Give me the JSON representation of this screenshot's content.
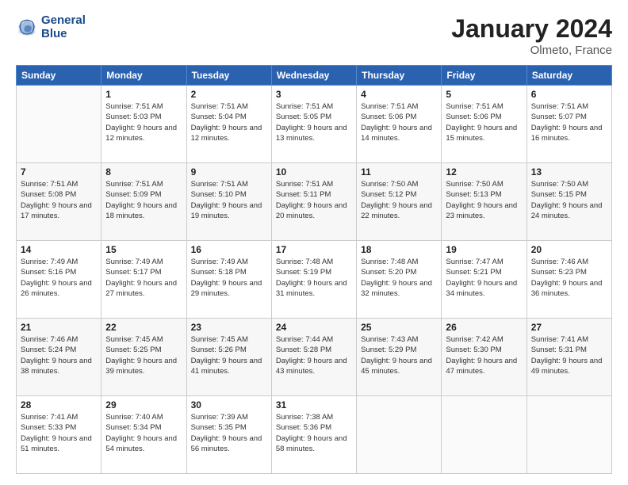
{
  "logo": {
    "line1": "General",
    "line2": "Blue"
  },
  "header": {
    "title": "January 2024",
    "subtitle": "Olmeto, France"
  },
  "weekdays": [
    "Sunday",
    "Monday",
    "Tuesday",
    "Wednesday",
    "Thursday",
    "Friday",
    "Saturday"
  ],
  "weeks": [
    [
      {
        "day": "",
        "sunrise": "",
        "sunset": "",
        "daylight": ""
      },
      {
        "day": "1",
        "sunrise": "Sunrise: 7:51 AM",
        "sunset": "Sunset: 5:03 PM",
        "daylight": "Daylight: 9 hours and 12 minutes."
      },
      {
        "day": "2",
        "sunrise": "Sunrise: 7:51 AM",
        "sunset": "Sunset: 5:04 PM",
        "daylight": "Daylight: 9 hours and 12 minutes."
      },
      {
        "day": "3",
        "sunrise": "Sunrise: 7:51 AM",
        "sunset": "Sunset: 5:05 PM",
        "daylight": "Daylight: 9 hours and 13 minutes."
      },
      {
        "day": "4",
        "sunrise": "Sunrise: 7:51 AM",
        "sunset": "Sunset: 5:06 PM",
        "daylight": "Daylight: 9 hours and 14 minutes."
      },
      {
        "day": "5",
        "sunrise": "Sunrise: 7:51 AM",
        "sunset": "Sunset: 5:06 PM",
        "daylight": "Daylight: 9 hours and 15 minutes."
      },
      {
        "day": "6",
        "sunrise": "Sunrise: 7:51 AM",
        "sunset": "Sunset: 5:07 PM",
        "daylight": "Daylight: 9 hours and 16 minutes."
      }
    ],
    [
      {
        "day": "7",
        "sunrise": "Sunrise: 7:51 AM",
        "sunset": "Sunset: 5:08 PM",
        "daylight": "Daylight: 9 hours and 17 minutes."
      },
      {
        "day": "8",
        "sunrise": "Sunrise: 7:51 AM",
        "sunset": "Sunset: 5:09 PM",
        "daylight": "Daylight: 9 hours and 18 minutes."
      },
      {
        "day": "9",
        "sunrise": "Sunrise: 7:51 AM",
        "sunset": "Sunset: 5:10 PM",
        "daylight": "Daylight: 9 hours and 19 minutes."
      },
      {
        "day": "10",
        "sunrise": "Sunrise: 7:51 AM",
        "sunset": "Sunset: 5:11 PM",
        "daylight": "Daylight: 9 hours and 20 minutes."
      },
      {
        "day": "11",
        "sunrise": "Sunrise: 7:50 AM",
        "sunset": "Sunset: 5:12 PM",
        "daylight": "Daylight: 9 hours and 22 minutes."
      },
      {
        "day": "12",
        "sunrise": "Sunrise: 7:50 AM",
        "sunset": "Sunset: 5:13 PM",
        "daylight": "Daylight: 9 hours and 23 minutes."
      },
      {
        "day": "13",
        "sunrise": "Sunrise: 7:50 AM",
        "sunset": "Sunset: 5:15 PM",
        "daylight": "Daylight: 9 hours and 24 minutes."
      }
    ],
    [
      {
        "day": "14",
        "sunrise": "Sunrise: 7:49 AM",
        "sunset": "Sunset: 5:16 PM",
        "daylight": "Daylight: 9 hours and 26 minutes."
      },
      {
        "day": "15",
        "sunrise": "Sunrise: 7:49 AM",
        "sunset": "Sunset: 5:17 PM",
        "daylight": "Daylight: 9 hours and 27 minutes."
      },
      {
        "day": "16",
        "sunrise": "Sunrise: 7:49 AM",
        "sunset": "Sunset: 5:18 PM",
        "daylight": "Daylight: 9 hours and 29 minutes."
      },
      {
        "day": "17",
        "sunrise": "Sunrise: 7:48 AM",
        "sunset": "Sunset: 5:19 PM",
        "daylight": "Daylight: 9 hours and 31 minutes."
      },
      {
        "day": "18",
        "sunrise": "Sunrise: 7:48 AM",
        "sunset": "Sunset: 5:20 PM",
        "daylight": "Daylight: 9 hours and 32 minutes."
      },
      {
        "day": "19",
        "sunrise": "Sunrise: 7:47 AM",
        "sunset": "Sunset: 5:21 PM",
        "daylight": "Daylight: 9 hours and 34 minutes."
      },
      {
        "day": "20",
        "sunrise": "Sunrise: 7:46 AM",
        "sunset": "Sunset: 5:23 PM",
        "daylight": "Daylight: 9 hours and 36 minutes."
      }
    ],
    [
      {
        "day": "21",
        "sunrise": "Sunrise: 7:46 AM",
        "sunset": "Sunset: 5:24 PM",
        "daylight": "Daylight: 9 hours and 38 minutes."
      },
      {
        "day": "22",
        "sunrise": "Sunrise: 7:45 AM",
        "sunset": "Sunset: 5:25 PM",
        "daylight": "Daylight: 9 hours and 39 minutes."
      },
      {
        "day": "23",
        "sunrise": "Sunrise: 7:45 AM",
        "sunset": "Sunset: 5:26 PM",
        "daylight": "Daylight: 9 hours and 41 minutes."
      },
      {
        "day": "24",
        "sunrise": "Sunrise: 7:44 AM",
        "sunset": "Sunset: 5:28 PM",
        "daylight": "Daylight: 9 hours and 43 minutes."
      },
      {
        "day": "25",
        "sunrise": "Sunrise: 7:43 AM",
        "sunset": "Sunset: 5:29 PM",
        "daylight": "Daylight: 9 hours and 45 minutes."
      },
      {
        "day": "26",
        "sunrise": "Sunrise: 7:42 AM",
        "sunset": "Sunset: 5:30 PM",
        "daylight": "Daylight: 9 hours and 47 minutes."
      },
      {
        "day": "27",
        "sunrise": "Sunrise: 7:41 AM",
        "sunset": "Sunset: 5:31 PM",
        "daylight": "Daylight: 9 hours and 49 minutes."
      }
    ],
    [
      {
        "day": "28",
        "sunrise": "Sunrise: 7:41 AM",
        "sunset": "Sunset: 5:33 PM",
        "daylight": "Daylight: 9 hours and 51 minutes."
      },
      {
        "day": "29",
        "sunrise": "Sunrise: 7:40 AM",
        "sunset": "Sunset: 5:34 PM",
        "daylight": "Daylight: 9 hours and 54 minutes."
      },
      {
        "day": "30",
        "sunrise": "Sunrise: 7:39 AM",
        "sunset": "Sunset: 5:35 PM",
        "daylight": "Daylight: 9 hours and 56 minutes."
      },
      {
        "day": "31",
        "sunrise": "Sunrise: 7:38 AM",
        "sunset": "Sunset: 5:36 PM",
        "daylight": "Daylight: 9 hours and 58 minutes."
      },
      {
        "day": "",
        "sunrise": "",
        "sunset": "",
        "daylight": ""
      },
      {
        "day": "",
        "sunrise": "",
        "sunset": "",
        "daylight": ""
      },
      {
        "day": "",
        "sunrise": "",
        "sunset": "",
        "daylight": ""
      }
    ]
  ]
}
